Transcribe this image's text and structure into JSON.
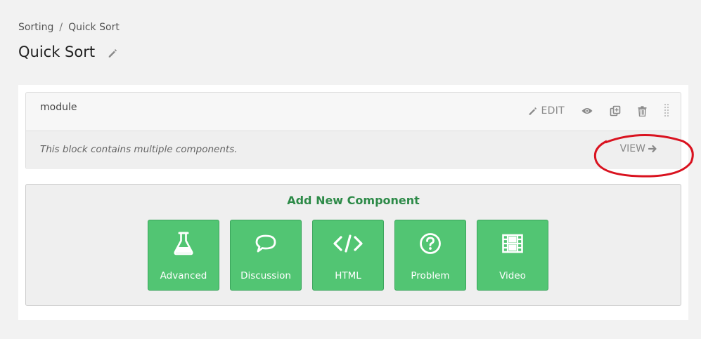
{
  "breadcrumb": {
    "parent": "Sorting",
    "separator": "/",
    "current": "Quick Sort"
  },
  "page": {
    "title": "Quick Sort",
    "title_edit_icon": "pencil-icon"
  },
  "block": {
    "name": "module",
    "description": "This block contains multiple components.",
    "actions": {
      "edit_label": "EDIT",
      "icons": [
        "pencil-icon",
        "eye-icon",
        "duplicate-icon",
        "trash-icon",
        "drag-handle-icon"
      ]
    },
    "view_label": "VIEW",
    "view_icon": "arrow-right-icon"
  },
  "add_component": {
    "title": "Add New Component",
    "buttons": [
      {
        "label": "Advanced",
        "icon": "flask-icon"
      },
      {
        "label": "Discussion",
        "icon": "speech-bubble-icon"
      },
      {
        "label": "HTML",
        "icon": "code-icon"
      },
      {
        "label": "Problem",
        "icon": "question-circle-icon"
      },
      {
        "label": "Video",
        "icon": "film-icon"
      }
    ]
  },
  "colors": {
    "accent_green": "#52c573",
    "title_green": "#2d8a48",
    "annotation_red": "#d9121f"
  }
}
